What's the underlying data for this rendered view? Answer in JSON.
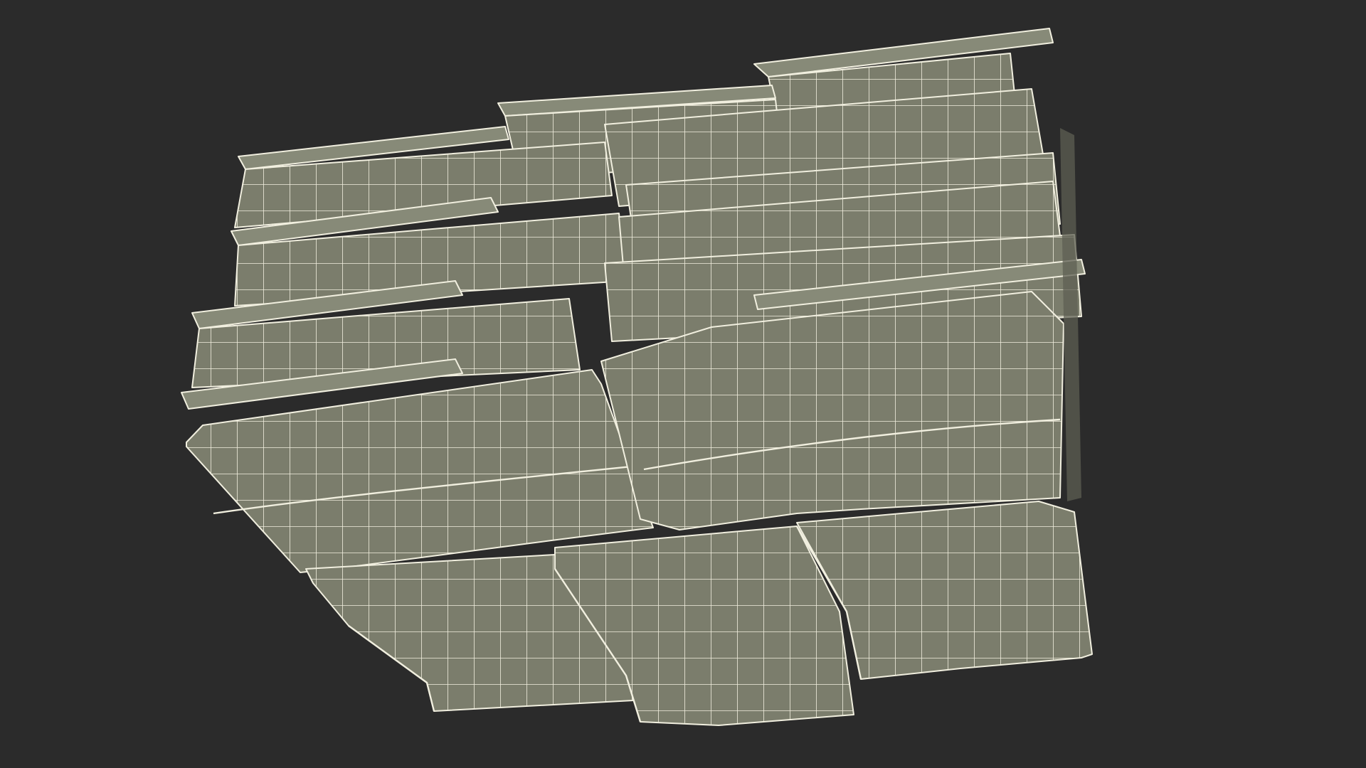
{
  "scene": {
    "background_color": "#2b2b2b",
    "mesh_fill_color": "#7b7d6c",
    "mesh_rim_color": "#878a78",
    "wire_color": "#f1efdf",
    "grid_cell_units": 37
  }
}
